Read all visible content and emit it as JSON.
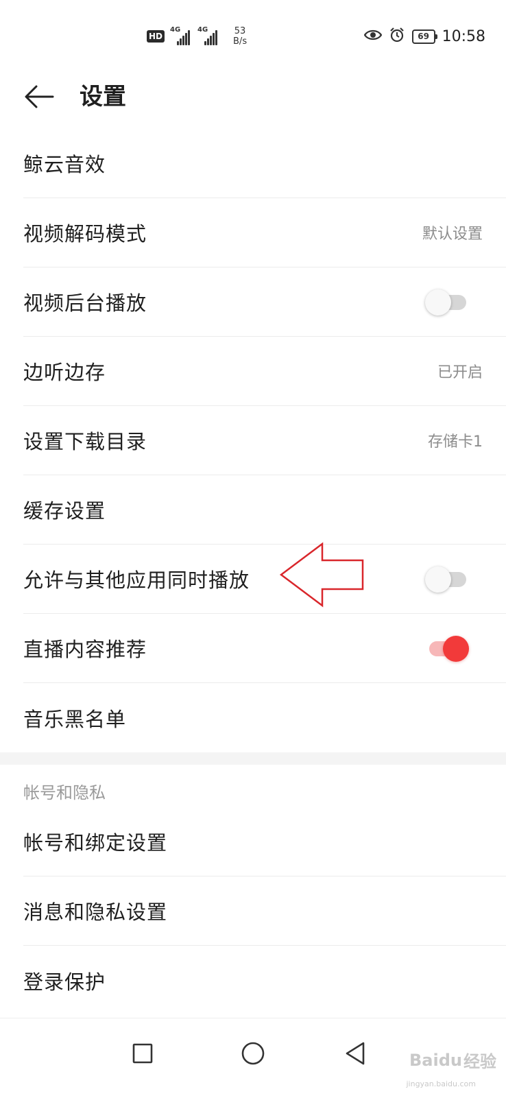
{
  "status_bar": {
    "hd_label": "HD",
    "network_1": "4G",
    "network_2": "4G",
    "speed_value": "53",
    "speed_unit": "B/s",
    "battery": "69",
    "time": "10:58",
    "icons": [
      "eye-icon",
      "alarm-icon"
    ]
  },
  "header": {
    "title": "设置"
  },
  "settings": [
    {
      "label": "鲸云音效",
      "value": "",
      "control": "none"
    },
    {
      "label": "视频解码模式",
      "value": "默认设置",
      "control": "value"
    },
    {
      "label": "视频后台播放",
      "value": "",
      "control": "toggle",
      "on": false
    },
    {
      "label": "边听边存",
      "value": "已开启",
      "control": "value"
    },
    {
      "label": "设置下载目录",
      "value": "存储卡1",
      "control": "value"
    },
    {
      "label": "缓存设置",
      "value": "",
      "control": "none"
    },
    {
      "label": "允许与其他应用同时播放",
      "value": "",
      "control": "toggle",
      "on": false
    },
    {
      "label": "直播内容推荐",
      "value": "",
      "control": "toggle",
      "on": true
    },
    {
      "label": "音乐黑名单",
      "value": "",
      "control": "none"
    }
  ],
  "account_section": {
    "header": "帐号和隐私",
    "items": [
      {
        "label": "帐号和绑定设置"
      },
      {
        "label": "消息和隐私设置"
      },
      {
        "label": "登录保护"
      }
    ]
  },
  "colors": {
    "toggle_on": "#f23a3a",
    "toggle_on_track": "#f7b7b8",
    "toggle_off_track": "#d6d6d6",
    "annotation_arrow": "#d9262b"
  },
  "watermark": {
    "brand": "Baidu",
    "suffix": "经验",
    "url": "jingyan.baidu.com"
  }
}
